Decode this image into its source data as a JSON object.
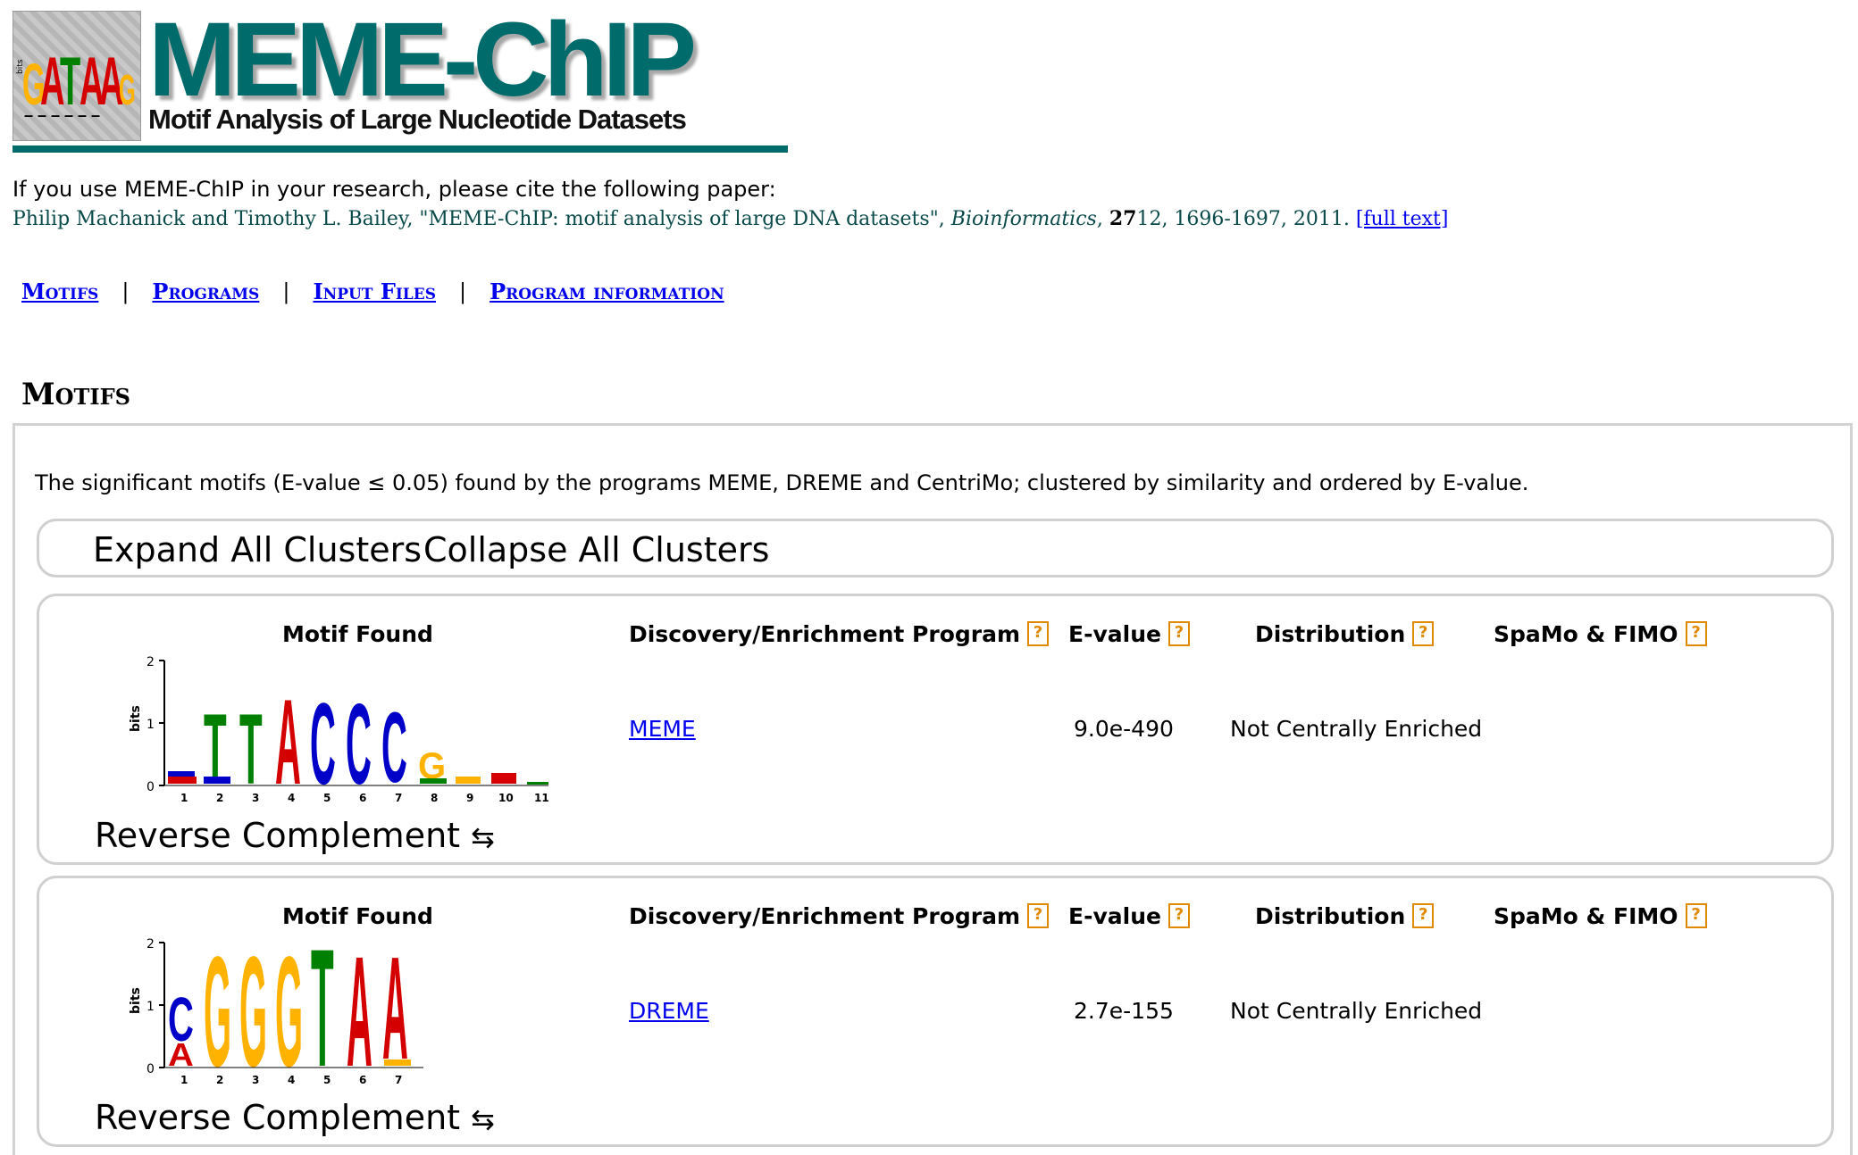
{
  "header": {
    "logo_letters": "GATAAG",
    "title": "MEME-ChIP",
    "subtitle": "Motif Analysis of Large Nucleotide Datasets"
  },
  "citation": {
    "intro": "If you use MEME-ChIP in your research, please cite the following paper:",
    "authors": "Philip Machanick and Timothy L. Bailey, \"MEME-ChIP: motif analysis of large DNA datasets\", ",
    "journal": "Bioinformatics",
    "volume": "27",
    "issue_pages": "12, 1696-1697, 2011.",
    "full_text_link": "[full text]"
  },
  "nav": {
    "items": [
      "Motifs",
      "Programs",
      "Input Files",
      "Program information"
    ],
    "separator": "|"
  },
  "section": {
    "title": "Motifs",
    "description": "The significant motifs (E-value ≤ 0.05) found by the programs MEME, DREME and CentriMo; clustered by similarity and ordered by E-value."
  },
  "cluster_controls": {
    "expand_label": "Expand All Clusters",
    "collapse_label": "Collapse All Clusters"
  },
  "columns": {
    "motif": "Motif Found",
    "program": "Discovery/Enrichment Program",
    "evalue": "E-value",
    "distribution": "Distribution",
    "spamo": "SpaMo & FIMO",
    "help_glyph": "?"
  },
  "clusters": [
    {
      "program": "MEME",
      "evalue": "9.0e-490",
      "distribution": "Not Centrally Enriched",
      "revcomp_label": "Reverse Complement",
      "revcomp_icon": "⇆",
      "logo": {
        "ylabel": "bits",
        "yticks": [
          "0",
          "1",
          "2"
        ],
        "consensus": "TTACCCG",
        "positions": [
          "1",
          "2",
          "3",
          "4",
          "5",
          "6",
          "7",
          "8",
          "9",
          "10",
          "11"
        ]
      }
    },
    {
      "program": "DREME",
      "evalue": "2.7e-155",
      "distribution": "Not Centrally Enriched",
      "revcomp_label": "Reverse Complement",
      "revcomp_icon": "⇆",
      "logo": {
        "ylabel": "bits",
        "yticks": [
          "0",
          "1",
          "2"
        ],
        "consensus": "CGGGTAA",
        "positions": [
          "1",
          "2",
          "3",
          "4",
          "5",
          "6",
          "7"
        ]
      }
    }
  ],
  "colors": {
    "brand_teal": "#006b6b",
    "link_blue": "#0000ee",
    "help_orange": "#e08a00",
    "A": "#d40000",
    "C": "#0000c8",
    "G": "#ffb300",
    "T": "#008000"
  }
}
